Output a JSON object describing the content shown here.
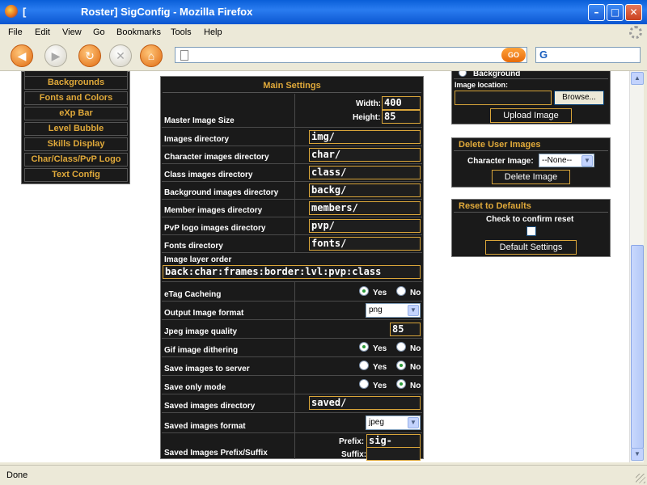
{
  "window": {
    "title_left": "[",
    "title": "Roster] SigConfig - Mozilla Firefox"
  },
  "menu": [
    "File",
    "Edit",
    "View",
    "Go",
    "Bookmarks",
    "Tools",
    "Help"
  ],
  "toolbar": {
    "url": "",
    "go_label": "GO",
    "search_value": ""
  },
  "leftnav": {
    "items": [
      "Backgrounds",
      "Fonts and Colors",
      "eXp Bar",
      "Level Bubble",
      "Skills Display",
      "Char/Class/PvP Logo",
      "Text Config"
    ]
  },
  "main": {
    "title": "Main Settings",
    "master_size": {
      "label": "Master Image Size",
      "width_label": "Width:",
      "width": "400",
      "height_label": "Height:",
      "height": "85"
    },
    "dirs": [
      {
        "label": "Images directory",
        "value": "img/"
      },
      {
        "label": "Character images directory",
        "value": "char/"
      },
      {
        "label": "Class images directory",
        "value": "class/"
      },
      {
        "label": "Background images directory",
        "value": "backg/"
      },
      {
        "label": "Member images directory",
        "value": "members/"
      },
      {
        "label": "PvP logo images directory",
        "value": "pvp/"
      },
      {
        "label": "Fonts directory",
        "value": "fonts/"
      }
    ],
    "layer_order": {
      "label": "Image layer order",
      "value": "back:char:frames:border:lvl:pvp:class"
    },
    "etag": {
      "label": "eTag Cacheing",
      "yes": "Yes",
      "no": "No",
      "selected": "yes"
    },
    "output_format": {
      "label": "Output Image format",
      "value": "png"
    },
    "jpeg_quality": {
      "label": "Jpeg image quality",
      "value": "85"
    },
    "gif_dither": {
      "label": "Gif image dithering",
      "yes": "Yes",
      "no": "No",
      "selected": "yes"
    },
    "save_server": {
      "label": "Save images to server",
      "yes": "Yes",
      "no": "No",
      "selected": "no"
    },
    "save_only": {
      "label": "Save only mode",
      "yes": "Yes",
      "no": "No",
      "selected": "no"
    },
    "saved_dir": {
      "label": "Saved images directory",
      "value": "saved/"
    },
    "saved_format": {
      "label": "Saved images format",
      "value": "jpeg"
    },
    "prefix_suffix": {
      "label": "Saved Images Prefix/Suffix",
      "prefix_label": "Prefix:",
      "prefix": "sig-",
      "suffix_label": "Suffix:",
      "suffix": ""
    }
  },
  "upload": {
    "radio_label": "Background",
    "location_label": "Image location:",
    "browse_label": "Browse...",
    "upload_label": "Upload Image"
  },
  "delete": {
    "title": "Delete User Images",
    "char_label": "Character Image:",
    "select_value": "--None--",
    "button": "Delete Image"
  },
  "reset": {
    "title": "Reset to Defaults",
    "confirm_label": "Check to confirm reset",
    "button": "Default Settings"
  },
  "status": "Done"
}
